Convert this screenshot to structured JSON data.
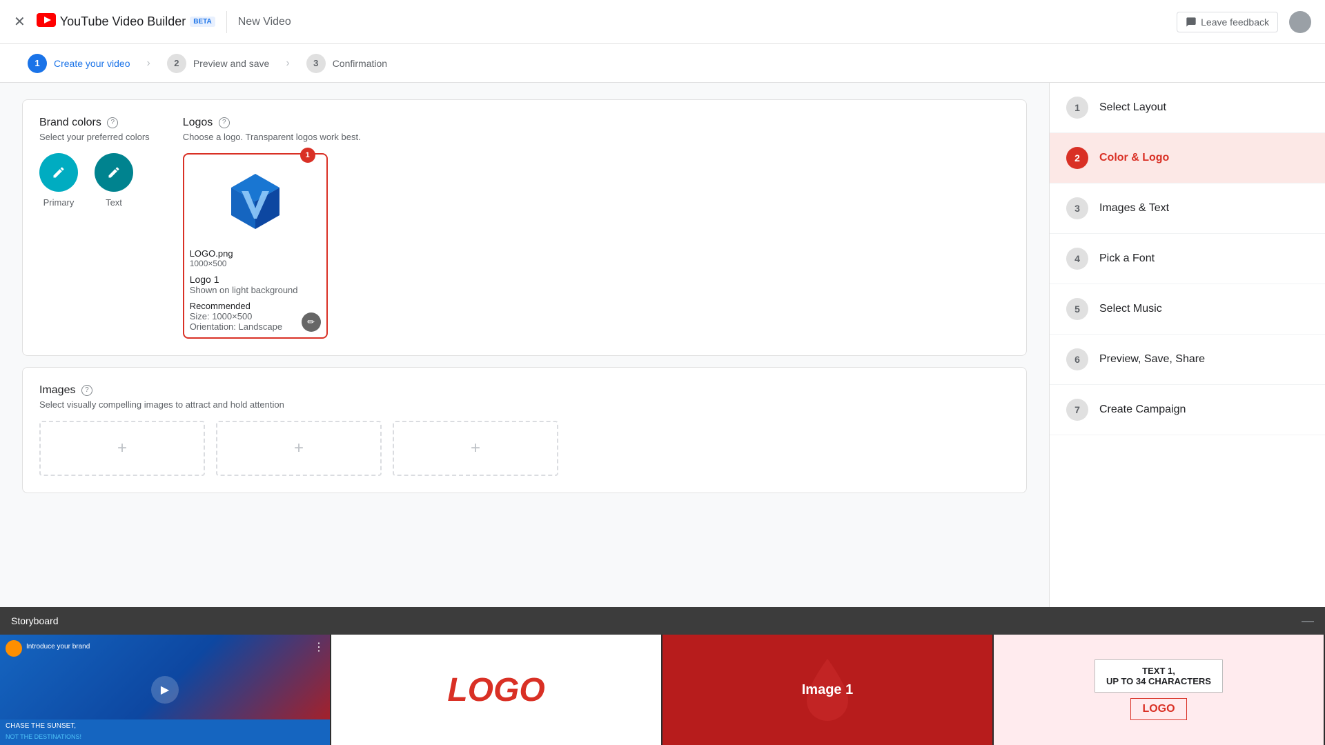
{
  "header": {
    "app_name": "YouTube Video Builder",
    "beta_label": "BETA",
    "page_title": "New Video",
    "feedback_label": "Leave feedback"
  },
  "steps": [
    {
      "number": "1",
      "label": "Create your video",
      "state": "active"
    },
    {
      "number": "2",
      "label": "Preview and save",
      "state": "inactive"
    },
    {
      "number": "3",
      "label": "Confirmation",
      "state": "inactive"
    }
  ],
  "brand_colors": {
    "title": "Brand colors",
    "subtitle": "Select your preferred colors",
    "primary_label": "Primary",
    "text_label": "Text"
  },
  "logos": {
    "title": "Logos",
    "subtitle": "Choose a logo. Transparent logos work best.",
    "badge": "1",
    "filename": "LOGO.png",
    "dimensions": "1000×500",
    "logo_name": "Logo 1",
    "background_desc": "Shown on light background",
    "recommended_label": "Recommended",
    "recommended_size": "Size: 1000×500",
    "recommended_orientation": "Orientation: Landscape"
  },
  "images": {
    "title": "Images",
    "subtitle": "Select visually compelling images to attract and hold attention"
  },
  "sidebar": {
    "items": [
      {
        "number": "1",
        "label": "Select Layout",
        "state": "future"
      },
      {
        "number": "2",
        "label": "Color & Logo",
        "state": "active"
      },
      {
        "number": "3",
        "label": "Images & Text",
        "state": "future"
      },
      {
        "number": "4",
        "label": "Pick a Font",
        "state": "future"
      },
      {
        "number": "5",
        "label": "Select Music",
        "state": "future"
      },
      {
        "number": "6",
        "label": "Preview, Save, Share",
        "state": "future"
      },
      {
        "number": "7",
        "label": "Create Campaign",
        "state": "future"
      }
    ]
  },
  "storyboard": {
    "title": "Storyboard",
    "frame1_title": "Introduce your brand",
    "frame1_caption1": "CHASE THE SUNSET,",
    "frame1_caption2": "NOT THE DESTINATIONS!",
    "frame2_logo": "LOGO",
    "frame3_image": "Image 1",
    "frame4_text1": "TEXT 1,",
    "frame4_text2": "UP TO 34 CHARACTERS",
    "frame4_logo": "LOGO"
  }
}
